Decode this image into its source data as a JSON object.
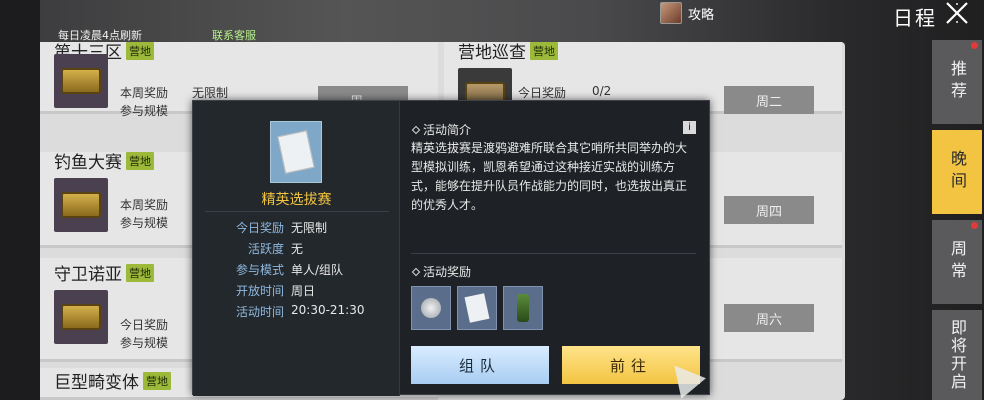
{
  "header": {
    "refresh_note": "每日凌晨4点刷新",
    "contact": "联系客服",
    "guide": "攻略",
    "title": "日程"
  },
  "cards": [
    {
      "title": "第十三区",
      "tag": "营地",
      "row1_label": "本周奖励",
      "row1_value": "无限制",
      "row2_label": "参与规模",
      "day": "周一"
    },
    {
      "title": "营地巡查",
      "tag": "营地",
      "row1_label": "今日奖励",
      "row1_value": "0/2",
      "day": "周二"
    },
    {
      "title": "钓鱼大赛",
      "tag": "营地",
      "row1_label": "本周奖励",
      "row2_label": "参与规模"
    },
    {
      "day": "周四"
    },
    {
      "title": "守卫诺亚",
      "tag": "营地",
      "row1_label": "今日奖励",
      "row2_label": "参与规模"
    },
    {
      "day": "周六"
    },
    {
      "title": "巨型畸变体",
      "tag": "营地"
    }
  ],
  "tabs": [
    {
      "label": "推荐",
      "dot": true
    },
    {
      "label": "晚间",
      "active": true
    },
    {
      "label": "周常",
      "dot": true
    },
    {
      "label": "即将开启"
    }
  ],
  "popup": {
    "name": "精英选拔赛",
    "info": [
      {
        "label": "今日奖励",
        "value": "无限制"
      },
      {
        "label": "活跃度",
        "value": "无"
      },
      {
        "label": "参与模式",
        "value": "单人/组队"
      },
      {
        "label": "开放时间",
        "value": "周日"
      },
      {
        "label": "活动时间",
        "value": "20:30-21:30"
      }
    ],
    "intro_title": "活动简介",
    "intro_text": "精英选拔赛是渡鸦避难所联合其它哨所共同举办的大型模拟训练，凯恩希望通过这种接近实战的训练方式，能够在提升队员作战能力的同时，也选拔出真正的优秀人才。",
    "info_icon": "i",
    "reward_title": "活动奖励",
    "rewards": [
      "coin-icon",
      "paper-icon",
      "bottle-icon"
    ],
    "btn_team": "组队",
    "btn_go": "前往"
  }
}
